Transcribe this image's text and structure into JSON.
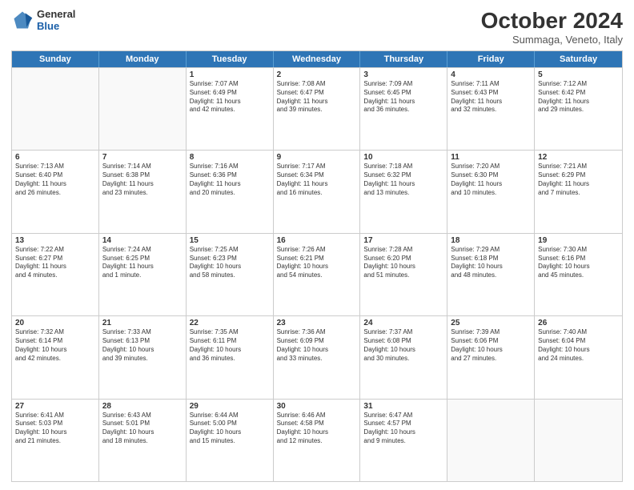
{
  "header": {
    "logo": {
      "general": "General",
      "blue": "Blue"
    },
    "title": "October 2024",
    "subtitle": "Summaga, Veneto, Italy"
  },
  "days": [
    "Sunday",
    "Monday",
    "Tuesday",
    "Wednesday",
    "Thursday",
    "Friday",
    "Saturday"
  ],
  "rows": [
    [
      {
        "day": "",
        "empty": true
      },
      {
        "day": "",
        "empty": true
      },
      {
        "day": "1",
        "lines": [
          "Sunrise: 7:07 AM",
          "Sunset: 6:49 PM",
          "Daylight: 11 hours",
          "and 42 minutes."
        ]
      },
      {
        "day": "2",
        "lines": [
          "Sunrise: 7:08 AM",
          "Sunset: 6:47 PM",
          "Daylight: 11 hours",
          "and 39 minutes."
        ]
      },
      {
        "day": "3",
        "lines": [
          "Sunrise: 7:09 AM",
          "Sunset: 6:45 PM",
          "Daylight: 11 hours",
          "and 36 minutes."
        ]
      },
      {
        "day": "4",
        "lines": [
          "Sunrise: 7:11 AM",
          "Sunset: 6:43 PM",
          "Daylight: 11 hours",
          "and 32 minutes."
        ]
      },
      {
        "day": "5",
        "lines": [
          "Sunrise: 7:12 AM",
          "Sunset: 6:42 PM",
          "Daylight: 11 hours",
          "and 29 minutes."
        ]
      }
    ],
    [
      {
        "day": "6",
        "lines": [
          "Sunrise: 7:13 AM",
          "Sunset: 6:40 PM",
          "Daylight: 11 hours",
          "and 26 minutes."
        ]
      },
      {
        "day": "7",
        "lines": [
          "Sunrise: 7:14 AM",
          "Sunset: 6:38 PM",
          "Daylight: 11 hours",
          "and 23 minutes."
        ]
      },
      {
        "day": "8",
        "lines": [
          "Sunrise: 7:16 AM",
          "Sunset: 6:36 PM",
          "Daylight: 11 hours",
          "and 20 minutes."
        ]
      },
      {
        "day": "9",
        "lines": [
          "Sunrise: 7:17 AM",
          "Sunset: 6:34 PM",
          "Daylight: 11 hours",
          "and 16 minutes."
        ]
      },
      {
        "day": "10",
        "lines": [
          "Sunrise: 7:18 AM",
          "Sunset: 6:32 PM",
          "Daylight: 11 hours",
          "and 13 minutes."
        ]
      },
      {
        "day": "11",
        "lines": [
          "Sunrise: 7:20 AM",
          "Sunset: 6:30 PM",
          "Daylight: 11 hours",
          "and 10 minutes."
        ]
      },
      {
        "day": "12",
        "lines": [
          "Sunrise: 7:21 AM",
          "Sunset: 6:29 PM",
          "Daylight: 11 hours",
          "and 7 minutes."
        ]
      }
    ],
    [
      {
        "day": "13",
        "lines": [
          "Sunrise: 7:22 AM",
          "Sunset: 6:27 PM",
          "Daylight: 11 hours",
          "and 4 minutes."
        ]
      },
      {
        "day": "14",
        "lines": [
          "Sunrise: 7:24 AM",
          "Sunset: 6:25 PM",
          "Daylight: 11 hours",
          "and 1 minute."
        ]
      },
      {
        "day": "15",
        "lines": [
          "Sunrise: 7:25 AM",
          "Sunset: 6:23 PM",
          "Daylight: 10 hours",
          "and 58 minutes."
        ]
      },
      {
        "day": "16",
        "lines": [
          "Sunrise: 7:26 AM",
          "Sunset: 6:21 PM",
          "Daylight: 10 hours",
          "and 54 minutes."
        ]
      },
      {
        "day": "17",
        "lines": [
          "Sunrise: 7:28 AM",
          "Sunset: 6:20 PM",
          "Daylight: 10 hours",
          "and 51 minutes."
        ]
      },
      {
        "day": "18",
        "lines": [
          "Sunrise: 7:29 AM",
          "Sunset: 6:18 PM",
          "Daylight: 10 hours",
          "and 48 minutes."
        ]
      },
      {
        "day": "19",
        "lines": [
          "Sunrise: 7:30 AM",
          "Sunset: 6:16 PM",
          "Daylight: 10 hours",
          "and 45 minutes."
        ]
      }
    ],
    [
      {
        "day": "20",
        "lines": [
          "Sunrise: 7:32 AM",
          "Sunset: 6:14 PM",
          "Daylight: 10 hours",
          "and 42 minutes."
        ]
      },
      {
        "day": "21",
        "lines": [
          "Sunrise: 7:33 AM",
          "Sunset: 6:13 PM",
          "Daylight: 10 hours",
          "and 39 minutes."
        ]
      },
      {
        "day": "22",
        "lines": [
          "Sunrise: 7:35 AM",
          "Sunset: 6:11 PM",
          "Daylight: 10 hours",
          "and 36 minutes."
        ]
      },
      {
        "day": "23",
        "lines": [
          "Sunrise: 7:36 AM",
          "Sunset: 6:09 PM",
          "Daylight: 10 hours",
          "and 33 minutes."
        ]
      },
      {
        "day": "24",
        "lines": [
          "Sunrise: 7:37 AM",
          "Sunset: 6:08 PM",
          "Daylight: 10 hours",
          "and 30 minutes."
        ]
      },
      {
        "day": "25",
        "lines": [
          "Sunrise: 7:39 AM",
          "Sunset: 6:06 PM",
          "Daylight: 10 hours",
          "and 27 minutes."
        ]
      },
      {
        "day": "26",
        "lines": [
          "Sunrise: 7:40 AM",
          "Sunset: 6:04 PM",
          "Daylight: 10 hours",
          "and 24 minutes."
        ]
      }
    ],
    [
      {
        "day": "27",
        "lines": [
          "Sunrise: 6:41 AM",
          "Sunset: 5:03 PM",
          "Daylight: 10 hours",
          "and 21 minutes."
        ]
      },
      {
        "day": "28",
        "lines": [
          "Sunrise: 6:43 AM",
          "Sunset: 5:01 PM",
          "Daylight: 10 hours",
          "and 18 minutes."
        ]
      },
      {
        "day": "29",
        "lines": [
          "Sunrise: 6:44 AM",
          "Sunset: 5:00 PM",
          "Daylight: 10 hours",
          "and 15 minutes."
        ]
      },
      {
        "day": "30",
        "lines": [
          "Sunrise: 6:46 AM",
          "Sunset: 4:58 PM",
          "Daylight: 10 hours",
          "and 12 minutes."
        ]
      },
      {
        "day": "31",
        "lines": [
          "Sunrise: 6:47 AM",
          "Sunset: 4:57 PM",
          "Daylight: 10 hours",
          "and 9 minutes."
        ]
      },
      {
        "day": "",
        "empty": true
      },
      {
        "day": "",
        "empty": true
      }
    ]
  ]
}
